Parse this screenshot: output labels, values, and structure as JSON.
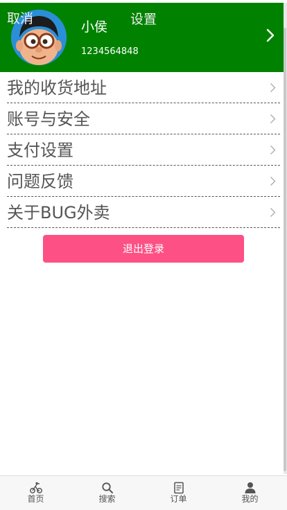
{
  "header": {
    "cancel_label": "取消",
    "title": "设置",
    "username": "小侯",
    "user_id": "1234564848"
  },
  "menu": {
    "items": [
      {
        "label": "我的收货地址"
      },
      {
        "label": "账号与安全"
      },
      {
        "label": "支付设置"
      },
      {
        "label": "问题反馈"
      },
      {
        "label": "关于BUG外卖"
      }
    ]
  },
  "logout_label": "退出登录",
  "tabbar": {
    "items": [
      {
        "label": "首页",
        "icon": "bike-icon"
      },
      {
        "label": "搜索",
        "icon": "search-icon"
      },
      {
        "label": "订单",
        "icon": "order-icon"
      },
      {
        "label": "我的",
        "icon": "user-icon"
      }
    ]
  },
  "colors": {
    "header_bg": "#008200",
    "logout_bg": "#fd5085",
    "menu_text": "#555555"
  }
}
